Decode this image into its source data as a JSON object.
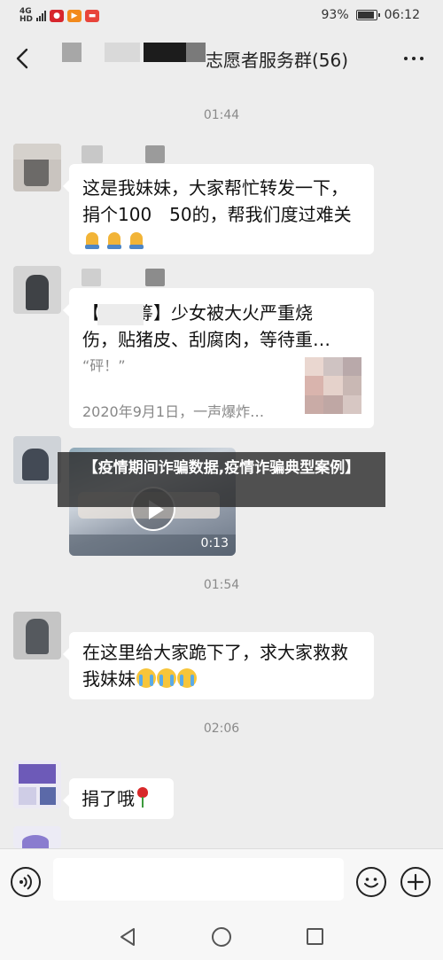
{
  "status_bar": {
    "network_top": "4G",
    "network_bottom": "HD",
    "battery_percent": "93%",
    "battery_level": 0.93,
    "time": "06:12"
  },
  "header": {
    "title": "志愿者服务群(56)"
  },
  "messages": [
    {
      "type": "timestamp",
      "text": "01:44"
    },
    {
      "type": "text",
      "lines": [
        "这是我妹妹，大家帮忙转发一下，",
        "捐个100　50的，帮我们度过难关"
      ],
      "emoji": "pray-emoji x3"
    },
    {
      "type": "link_card",
      "title_lines": [
        "【　　筹】少女被大火严重烧",
        "伤，贴猪皮、刮腐肉，等待重…"
      ],
      "desc": "“砰！”",
      "source": "2020年9月1日，一声爆炸…"
    },
    {
      "type": "video",
      "duration": "0:13"
    },
    {
      "type": "timestamp",
      "text": "01:54"
    },
    {
      "type": "text",
      "lines": [
        "在这里给大家跪下了，求大家救救",
        "我妹妹"
      ],
      "emoji": "crying-emoji x3"
    },
    {
      "type": "timestamp",
      "text": "02:06"
    },
    {
      "type": "text",
      "lines": [
        "捐了哦"
      ],
      "emoji": "rose-emoji"
    }
  ],
  "overlay": {
    "text": "【疫情期间诈骗数据,疫情诈骗典型案例】"
  },
  "input_bar": {
    "placeholder": ""
  },
  "colors": {
    "chat_background": "#ededed",
    "bubble": "#ffffff",
    "timestamp_text": "#8a8a8a"
  },
  "icons": [
    "back-icon",
    "more-icon",
    "voice-icon",
    "emoji-icon",
    "plus-icon",
    "play-icon",
    "nav-back-icon",
    "nav-home-icon",
    "nav-recent-icon"
  ]
}
